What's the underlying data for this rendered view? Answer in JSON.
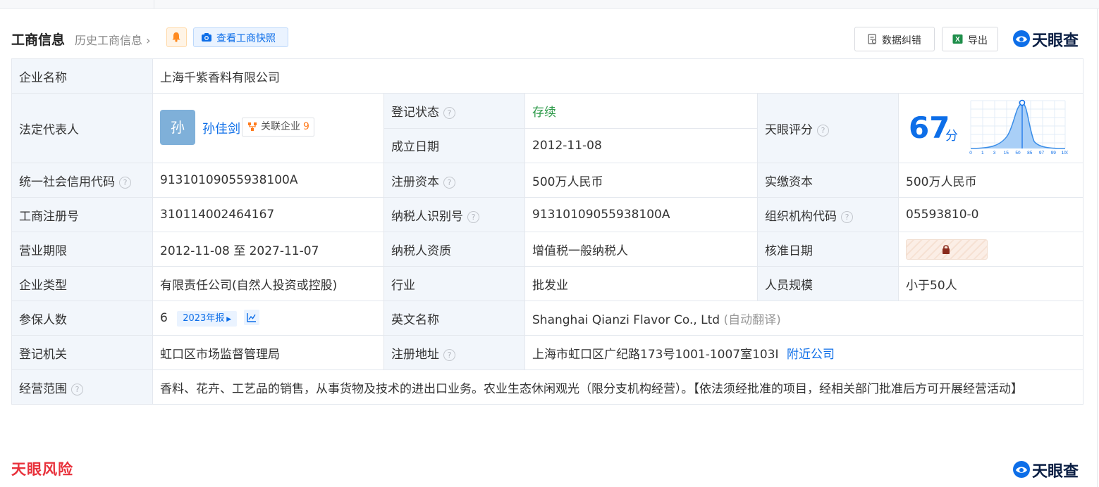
{
  "header": {
    "title": "工商信息",
    "history_link": "历史工商信息",
    "snapshot_button": "查看工商快照",
    "correct_button": "数据纠错",
    "export_button": "导出",
    "brand": "天眼查"
  },
  "rows": {
    "company_name": {
      "label": "企业名称",
      "value": "上海千紫香料有限公司"
    },
    "legal_rep": {
      "label": "法定代表人",
      "avatar_char": "孙",
      "name": "孙佳剑",
      "related_label": "关联企业",
      "related_count": "9"
    },
    "reg_status": {
      "label": "登记状态",
      "value": "存续"
    },
    "found_date": {
      "label": "成立日期",
      "value": "2012-11-08"
    },
    "tianyan_score": {
      "label": "天眼评分",
      "score": "67",
      "unit": "分",
      "axis_ticks": [
        "0",
        "1",
        "3",
        "15",
        "50",
        "85",
        "97",
        "99",
        "100"
      ]
    },
    "credit_code": {
      "label": "统一社会信用代码",
      "value": "91310109055938100A"
    },
    "reg_capital": {
      "label": "注册资本",
      "value": "500万人民币"
    },
    "paid_capital": {
      "label": "实缴资本",
      "value": "500万人民币"
    },
    "reg_number": {
      "label": "工商注册号",
      "value": "310114002464167"
    },
    "tax_id": {
      "label": "纳税人识别号",
      "value": "91310109055938100A"
    },
    "org_code": {
      "label": "组织机构代码",
      "value": "05593810-0"
    },
    "business_term": {
      "label": "营业期限",
      "value": "2012-11-08 至 2027-11-07"
    },
    "taxpayer_type": {
      "label": "纳税人资质",
      "value": "增值税一般纳税人"
    },
    "approval_date": {
      "label": "核准日期"
    },
    "company_type": {
      "label": "企业类型",
      "value": "有限责任公司(自然人投资或控股)"
    },
    "industry": {
      "label": "行业",
      "value": "批发业"
    },
    "staff_size": {
      "label": "人员规模",
      "value": "小于50人"
    },
    "insured": {
      "label": "参保人数",
      "value": "6",
      "year_badge": "2023年报"
    },
    "english_name": {
      "label": "英文名称",
      "value": "Shanghai Qianzi Flavor Co., Ltd",
      "note": "(自动翻译)"
    },
    "reg_authority": {
      "label": "登记机关",
      "value": "虹口区市场监督管理局"
    },
    "reg_address": {
      "label": "注册地址",
      "value": "上海市虹口区广纪路173号1001-1007室103I",
      "nearby_link": "附近公司"
    },
    "business_scope": {
      "label": "经营范围",
      "value": "香料、花卉、工艺品的销售，从事货物及技术的进出口业务。农业生态休闲观光（限分支机构经营）。【依法须经批准的项目，经相关部门批准后方可开展经营活动】"
    }
  },
  "footer": {
    "risk_brand": "天眼风险",
    "brand": "天眼查"
  },
  "colors": {
    "primary": "#0d6ee8",
    "status_green": "#2e9a4a",
    "label_bg": "#f2f6fb",
    "risk_red": "#e8313b"
  }
}
